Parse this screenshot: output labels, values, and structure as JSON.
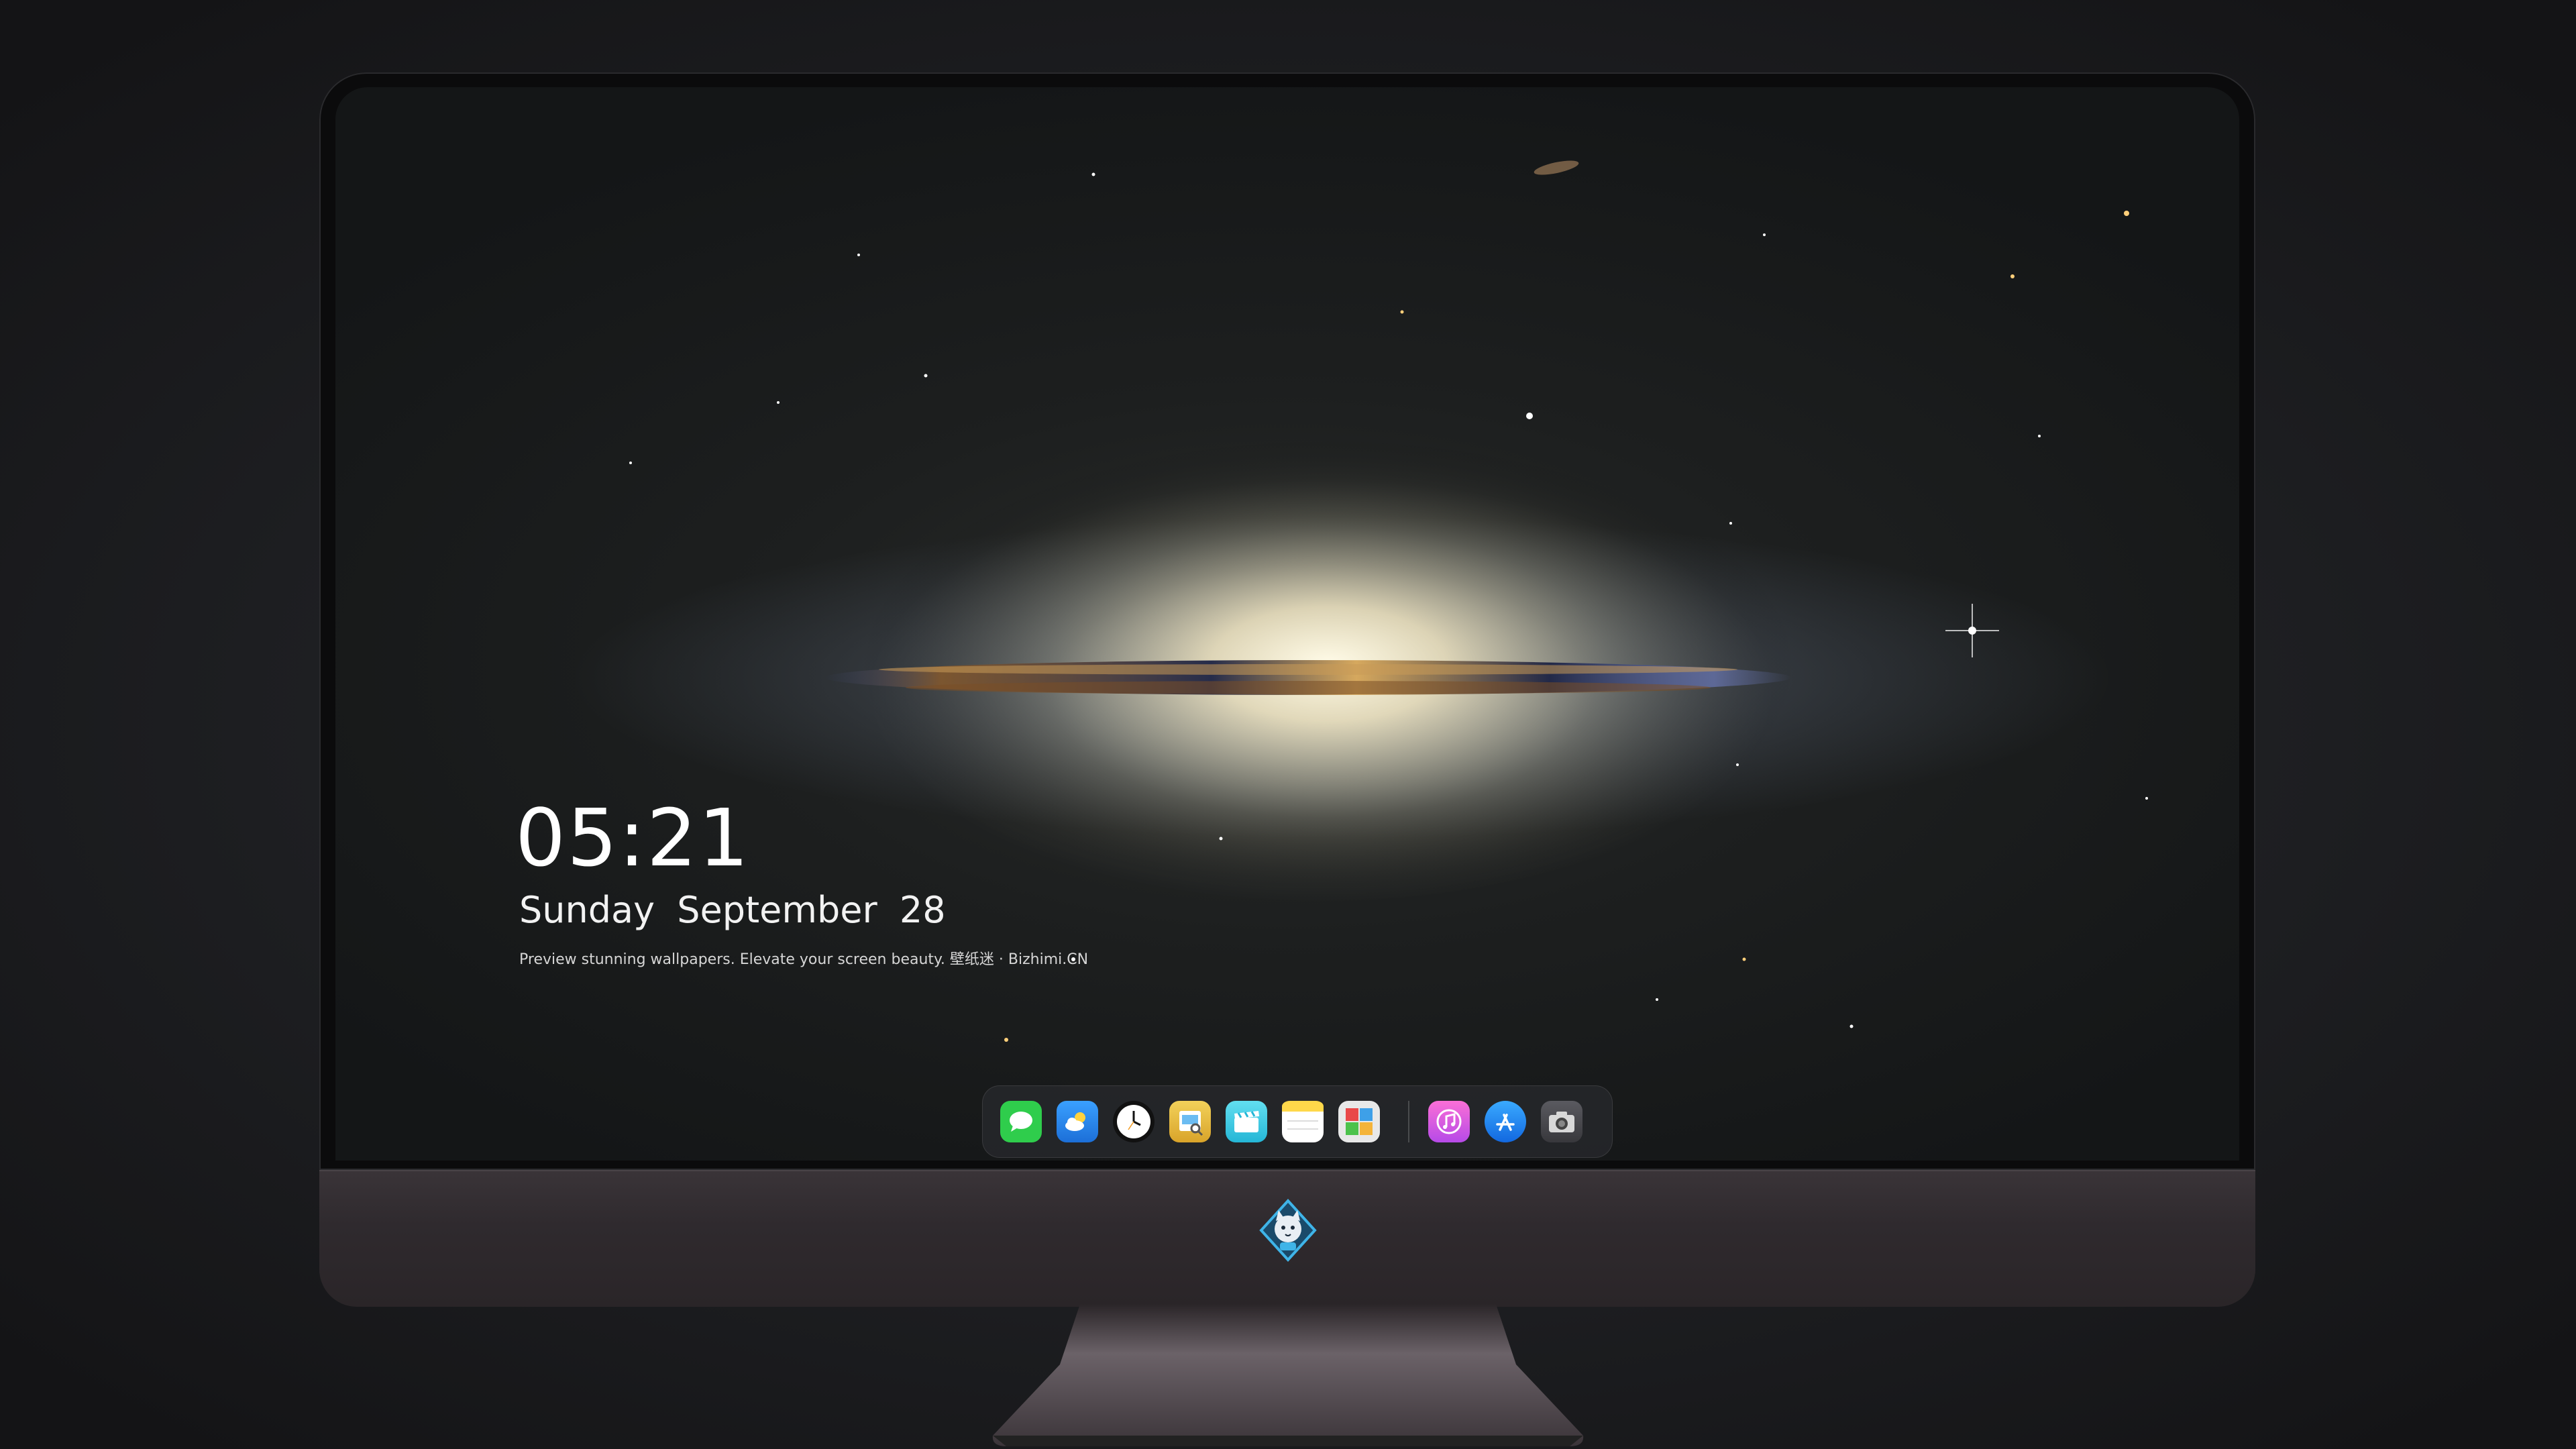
{
  "lock_screen": {
    "time": "05:21",
    "weekday": "Sunday",
    "month": "September",
    "day": "28",
    "tagline": "Preview stunning wallpapers. Elevate your screen beauty. 壁纸迷 · Bizhimi.CN"
  },
  "dock": {
    "apps": [
      {
        "name": "messages-icon",
        "color": "#2fcd4c"
      },
      {
        "name": "weather-icon",
        "color": "#2b8ef2"
      },
      {
        "name": "clock-icon",
        "color": "#1a1a1a"
      },
      {
        "name": "preview-icon",
        "color": "#e9c84a"
      },
      {
        "name": "clips-icon",
        "color": "#4fd1e6"
      },
      {
        "name": "notes-icon",
        "color": "#ffd84a"
      },
      {
        "name": "photo-booth-icon",
        "color": "#e8e8e8"
      }
    ],
    "pinned": [
      {
        "name": "itunes-icon",
        "color": "#f25ac8"
      },
      {
        "name": "app-store-icon",
        "color": "#1f8ff5"
      },
      {
        "name": "camera-icon",
        "color": "#4a4a4e"
      }
    ]
  },
  "monitor": {
    "chin_logo": "wolf-mascot-logo",
    "bezel_color": "#0b0b0c",
    "chin_color": "#332d31"
  }
}
